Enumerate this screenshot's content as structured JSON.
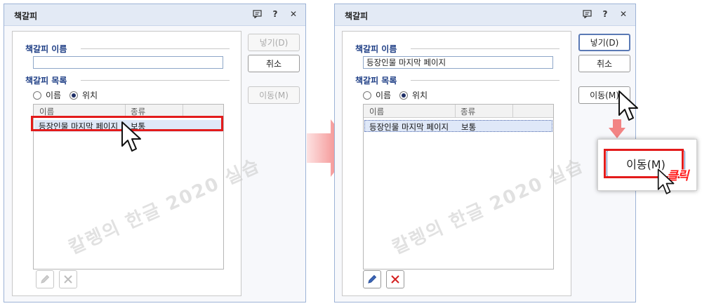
{
  "dialogs": [
    {
      "title": "책갈피",
      "bookmark_name_label": "책갈피 이름",
      "bookmark_name_value": "",
      "bookmark_list_label": "책갈피 목록",
      "sort_options": [
        "이름",
        "위치"
      ],
      "sort_selected": "위치",
      "list_columns": [
        "이름",
        "종류"
      ],
      "rows": [
        {
          "name": "등장인물 마지막 페이지",
          "kind": "보통"
        }
      ],
      "buttons": {
        "insert": "넣기(D)",
        "cancel": "취소",
        "move": "이동(M)"
      },
      "button_states": {
        "insert": "disabled",
        "move": "disabled",
        "edit": "disabled",
        "delete": "disabled"
      }
    },
    {
      "title": "책갈피",
      "bookmark_name_label": "책갈피 이름",
      "bookmark_name_value": "등장인물 마지막 페이지",
      "bookmark_list_label": "책갈피 목록",
      "sort_options": [
        "이름",
        "위치"
      ],
      "sort_selected": "위치",
      "list_columns": [
        "이름",
        "종류"
      ],
      "rows": [
        {
          "name": "등장인물 마지막 페이지",
          "kind": "보통"
        }
      ],
      "buttons": {
        "insert": "넣기(D)",
        "cancel": "취소",
        "move": "이동(M)"
      },
      "button_states": {
        "insert": "enabled",
        "move": "enabled",
        "edit": "enabled",
        "delete": "enabled"
      }
    }
  ],
  "popup_button": "이동(M)",
  "click_label": "클릭",
  "watermark": "칼렝의 한글 2020 실습",
  "colors": {
    "highlight": "#e31b1b",
    "arrow": "#f06a6a",
    "title_bar": "#e3eaf5",
    "section_label": "#1f3f86"
  }
}
